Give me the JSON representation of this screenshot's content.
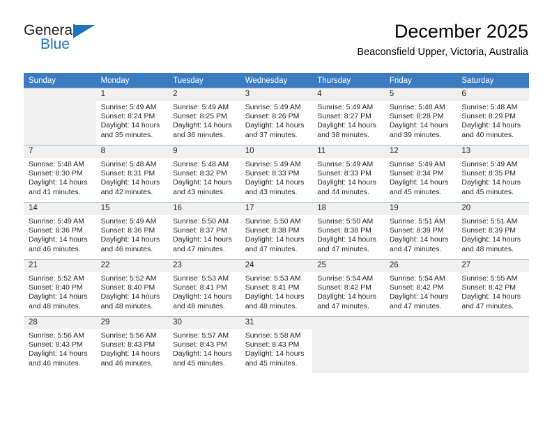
{
  "brand": {
    "name_part1": "General",
    "name_part2": "Blue",
    "triangle_color": "#1b75bb",
    "text_color": "#231f20"
  },
  "header": {
    "title": "December 2025",
    "subtitle": "Beaconsfield Upper, Victoria, Australia"
  },
  "theme": {
    "header_row_bg": "#3a7cc0",
    "header_row_text": "#ffffff",
    "daynum_bg": "#f0f0f0",
    "cell_border": "#9fb8d4",
    "blank_cell_bg": "#f0f0f0"
  },
  "calendar": {
    "weekday_headers": [
      "Sunday",
      "Monday",
      "Tuesday",
      "Wednesday",
      "Thursday",
      "Friday",
      "Saturday"
    ],
    "weeks": [
      [
        {
          "day": "",
          "blank": true
        },
        {
          "day": "1",
          "sunrise": "Sunrise: 5:49 AM",
          "sunset": "Sunset: 8:24 PM",
          "daylight_line1": "Daylight: 14 hours",
          "daylight_line2": "and 35 minutes."
        },
        {
          "day": "2",
          "sunrise": "Sunrise: 5:49 AM",
          "sunset": "Sunset: 8:25 PM",
          "daylight_line1": "Daylight: 14 hours",
          "daylight_line2": "and 36 minutes."
        },
        {
          "day": "3",
          "sunrise": "Sunrise: 5:49 AM",
          "sunset": "Sunset: 8:26 PM",
          "daylight_line1": "Daylight: 14 hours",
          "daylight_line2": "and 37 minutes."
        },
        {
          "day": "4",
          "sunrise": "Sunrise: 5:49 AM",
          "sunset": "Sunset: 8:27 PM",
          "daylight_line1": "Daylight: 14 hours",
          "daylight_line2": "and 38 minutes."
        },
        {
          "day": "5",
          "sunrise": "Sunrise: 5:48 AM",
          "sunset": "Sunset: 8:28 PM",
          "daylight_line1": "Daylight: 14 hours",
          "daylight_line2": "and 39 minutes."
        },
        {
          "day": "6",
          "sunrise": "Sunrise: 5:48 AM",
          "sunset": "Sunset: 8:29 PM",
          "daylight_line1": "Daylight: 14 hours",
          "daylight_line2": "and 40 minutes."
        }
      ],
      [
        {
          "day": "7",
          "sunrise": "Sunrise: 5:48 AM",
          "sunset": "Sunset: 8:30 PM",
          "daylight_line1": "Daylight: 14 hours",
          "daylight_line2": "and 41 minutes."
        },
        {
          "day": "8",
          "sunrise": "Sunrise: 5:48 AM",
          "sunset": "Sunset: 8:31 PM",
          "daylight_line1": "Daylight: 14 hours",
          "daylight_line2": "and 42 minutes."
        },
        {
          "day": "9",
          "sunrise": "Sunrise: 5:48 AM",
          "sunset": "Sunset: 8:32 PM",
          "daylight_line1": "Daylight: 14 hours",
          "daylight_line2": "and 43 minutes."
        },
        {
          "day": "10",
          "sunrise": "Sunrise: 5:49 AM",
          "sunset": "Sunset: 8:33 PM",
          "daylight_line1": "Daylight: 14 hours",
          "daylight_line2": "and 43 minutes."
        },
        {
          "day": "11",
          "sunrise": "Sunrise: 5:49 AM",
          "sunset": "Sunset: 8:33 PM",
          "daylight_line1": "Daylight: 14 hours",
          "daylight_line2": "and 44 minutes."
        },
        {
          "day": "12",
          "sunrise": "Sunrise: 5:49 AM",
          "sunset": "Sunset: 8:34 PM",
          "daylight_line1": "Daylight: 14 hours",
          "daylight_line2": "and 45 minutes."
        },
        {
          "day": "13",
          "sunrise": "Sunrise: 5:49 AM",
          "sunset": "Sunset: 8:35 PM",
          "daylight_line1": "Daylight: 14 hours",
          "daylight_line2": "and 45 minutes."
        }
      ],
      [
        {
          "day": "14",
          "sunrise": "Sunrise: 5:49 AM",
          "sunset": "Sunset: 8:36 PM",
          "daylight_line1": "Daylight: 14 hours",
          "daylight_line2": "and 46 minutes."
        },
        {
          "day": "15",
          "sunrise": "Sunrise: 5:49 AM",
          "sunset": "Sunset: 8:36 PM",
          "daylight_line1": "Daylight: 14 hours",
          "daylight_line2": "and 46 minutes."
        },
        {
          "day": "16",
          "sunrise": "Sunrise: 5:50 AM",
          "sunset": "Sunset: 8:37 PM",
          "daylight_line1": "Daylight: 14 hours",
          "daylight_line2": "and 47 minutes."
        },
        {
          "day": "17",
          "sunrise": "Sunrise: 5:50 AM",
          "sunset": "Sunset: 8:38 PM",
          "daylight_line1": "Daylight: 14 hours",
          "daylight_line2": "and 47 minutes."
        },
        {
          "day": "18",
          "sunrise": "Sunrise: 5:50 AM",
          "sunset": "Sunset: 8:38 PM",
          "daylight_line1": "Daylight: 14 hours",
          "daylight_line2": "and 47 minutes."
        },
        {
          "day": "19",
          "sunrise": "Sunrise: 5:51 AM",
          "sunset": "Sunset: 8:39 PM",
          "daylight_line1": "Daylight: 14 hours",
          "daylight_line2": "and 47 minutes."
        },
        {
          "day": "20",
          "sunrise": "Sunrise: 5:51 AM",
          "sunset": "Sunset: 8:39 PM",
          "daylight_line1": "Daylight: 14 hours",
          "daylight_line2": "and 48 minutes."
        }
      ],
      [
        {
          "day": "21",
          "sunrise": "Sunrise: 5:52 AM",
          "sunset": "Sunset: 8:40 PM",
          "daylight_line1": "Daylight: 14 hours",
          "daylight_line2": "and 48 minutes."
        },
        {
          "day": "22",
          "sunrise": "Sunrise: 5:52 AM",
          "sunset": "Sunset: 8:40 PM",
          "daylight_line1": "Daylight: 14 hours",
          "daylight_line2": "and 48 minutes."
        },
        {
          "day": "23",
          "sunrise": "Sunrise: 5:53 AM",
          "sunset": "Sunset: 8:41 PM",
          "daylight_line1": "Daylight: 14 hours",
          "daylight_line2": "and 48 minutes."
        },
        {
          "day": "24",
          "sunrise": "Sunrise: 5:53 AM",
          "sunset": "Sunset: 8:41 PM",
          "daylight_line1": "Daylight: 14 hours",
          "daylight_line2": "and 48 minutes."
        },
        {
          "day": "25",
          "sunrise": "Sunrise: 5:54 AM",
          "sunset": "Sunset: 8:42 PM",
          "daylight_line1": "Daylight: 14 hours",
          "daylight_line2": "and 47 minutes."
        },
        {
          "day": "26",
          "sunrise": "Sunrise: 5:54 AM",
          "sunset": "Sunset: 8:42 PM",
          "daylight_line1": "Daylight: 14 hours",
          "daylight_line2": "and 47 minutes."
        },
        {
          "day": "27",
          "sunrise": "Sunrise: 5:55 AM",
          "sunset": "Sunset: 8:42 PM",
          "daylight_line1": "Daylight: 14 hours",
          "daylight_line2": "and 47 minutes."
        }
      ],
      [
        {
          "day": "28",
          "sunrise": "Sunrise: 5:56 AM",
          "sunset": "Sunset: 8:43 PM",
          "daylight_line1": "Daylight: 14 hours",
          "daylight_line2": "and 46 minutes."
        },
        {
          "day": "29",
          "sunrise": "Sunrise: 5:56 AM",
          "sunset": "Sunset: 8:43 PM",
          "daylight_line1": "Daylight: 14 hours",
          "daylight_line2": "and 46 minutes."
        },
        {
          "day": "30",
          "sunrise": "Sunrise: 5:57 AM",
          "sunset": "Sunset: 8:43 PM",
          "daylight_line1": "Daylight: 14 hours",
          "daylight_line2": "and 45 minutes."
        },
        {
          "day": "31",
          "sunrise": "Sunrise: 5:58 AM",
          "sunset": "Sunset: 8:43 PM",
          "daylight_line1": "Daylight: 14 hours",
          "daylight_line2": "and 45 minutes."
        },
        {
          "day": "",
          "blank": true
        },
        {
          "day": "",
          "blank": true
        },
        {
          "day": "",
          "blank": true
        }
      ]
    ]
  }
}
